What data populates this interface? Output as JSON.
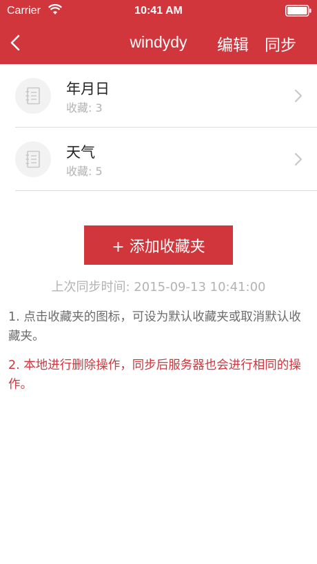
{
  "status_bar": {
    "carrier": "Carrier",
    "time": "10:41 AM"
  },
  "nav": {
    "title": "windydy",
    "edit_label": "编辑",
    "sync_label": "同步"
  },
  "folders": [
    {
      "name": "年月日",
      "count": "收藏: 3"
    },
    {
      "name": "天气",
      "count": "收藏: 5"
    }
  ],
  "add_button_label": "+ 添加收藏夹",
  "last_sync": "上次同步时间:  2015-09-13 10:41:00",
  "notes": [
    "1. 点击收藏夹的图标，可设为默认收藏夹或取消默认收藏夹。",
    "2. 本地进行删除操作，同步后服务器也会进行相同的操作。"
  ],
  "colors": {
    "accent": "#d0363c",
    "muted_text": "#b3b3b3",
    "body_text": "#6b6b6b"
  },
  "icons": [
    "wifi-icon",
    "battery-icon",
    "back-icon",
    "notebook-icon",
    "chevron-right-icon"
  ]
}
